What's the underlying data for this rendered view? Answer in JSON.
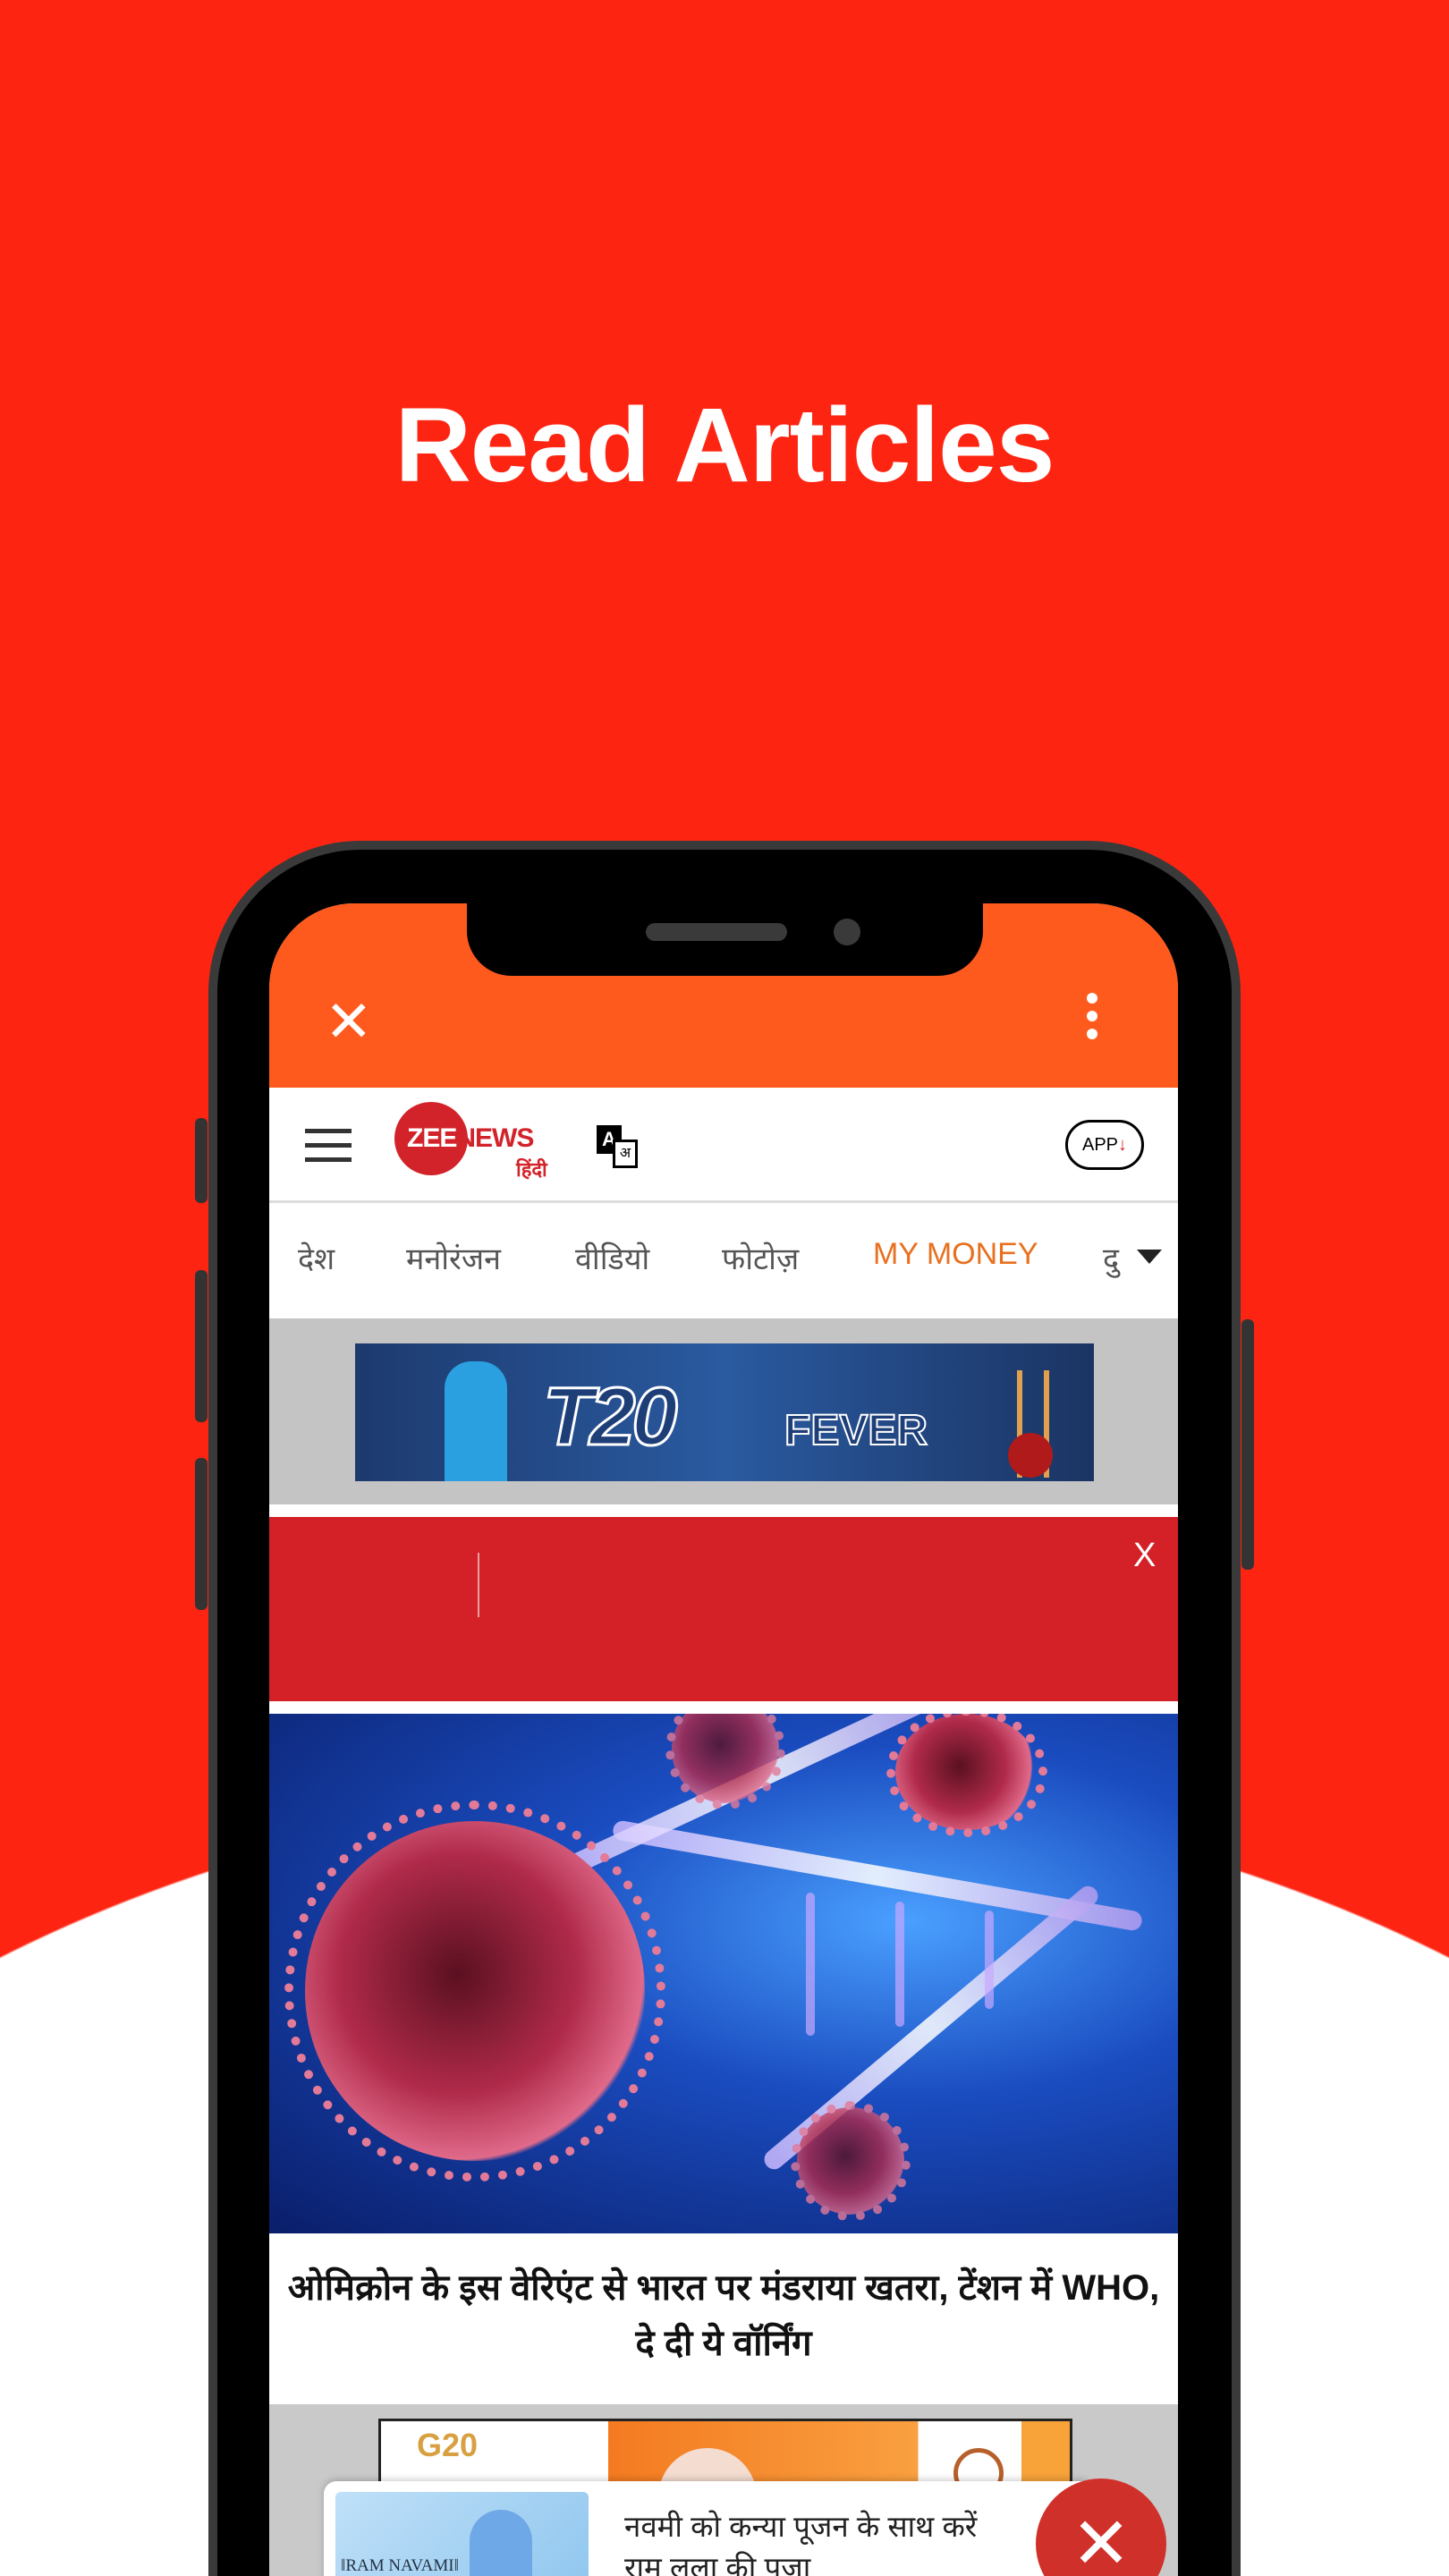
{
  "promo": {
    "title": "Read Articles",
    "background": "#fe2412"
  },
  "browser": {
    "close_icon": "close-icon",
    "menu_icon": "more-vertical-icon",
    "toolbar_color": "#fe5a1d"
  },
  "site_header": {
    "logo_text_1": "ZEE",
    "logo_text_2": "NEWS",
    "logo_sub": "हिंदी",
    "translate_a": "A",
    "translate_b": "अ",
    "app_label": "APP",
    "app_icon": "↓"
  },
  "tabs": [
    {
      "label": "देश",
      "active": false
    },
    {
      "label": "मनोरंजन",
      "active": false
    },
    {
      "label": "वीडियो",
      "active": false
    },
    {
      "label": "फोटोज़",
      "active": false
    },
    {
      "label": "MY MONEY",
      "active": true
    },
    {
      "label": "दु",
      "active": false
    }
  ],
  "banner_ad": {
    "text_main": "T20",
    "text_sub": "FEVER"
  },
  "red_bar": {
    "close": "X"
  },
  "article": {
    "headline": "ओमिक्रोन के इस वेरिएंट से भारत पर मंडराया खतरा, टेंशन में WHO, दे दी ये वॉर्निंग"
  },
  "ad2": {
    "logo": "G20"
  },
  "popup": {
    "image_label": "‖RAM NAVAMI‖",
    "text": "नवमी को कन्या पूजन के साथ करें राम लला की पूजा",
    "close": "✕"
  }
}
